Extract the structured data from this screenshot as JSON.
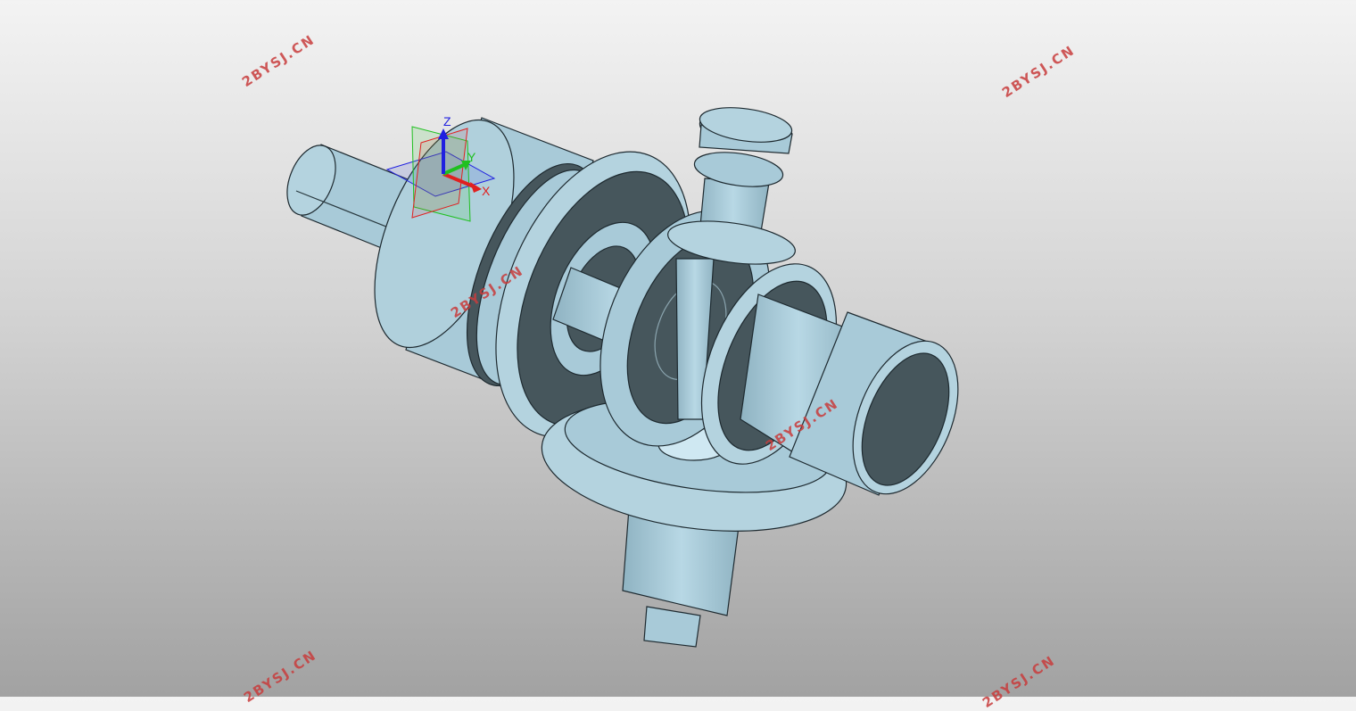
{
  "watermark": {
    "text": "2BYSJ.CN",
    "color": "#c83c3c"
  },
  "triad": {
    "x_label": "X",
    "y_label": "Y",
    "z_label": "Z",
    "x_color": "#e02020",
    "y_color": "#20c020",
    "z_color": "#2020e0"
  },
  "model": {
    "fill_color": "#a8cad8",
    "dark_color": "#46565c",
    "highlight_color": "#cfe8f2",
    "edge_color": "#1e2a30"
  }
}
